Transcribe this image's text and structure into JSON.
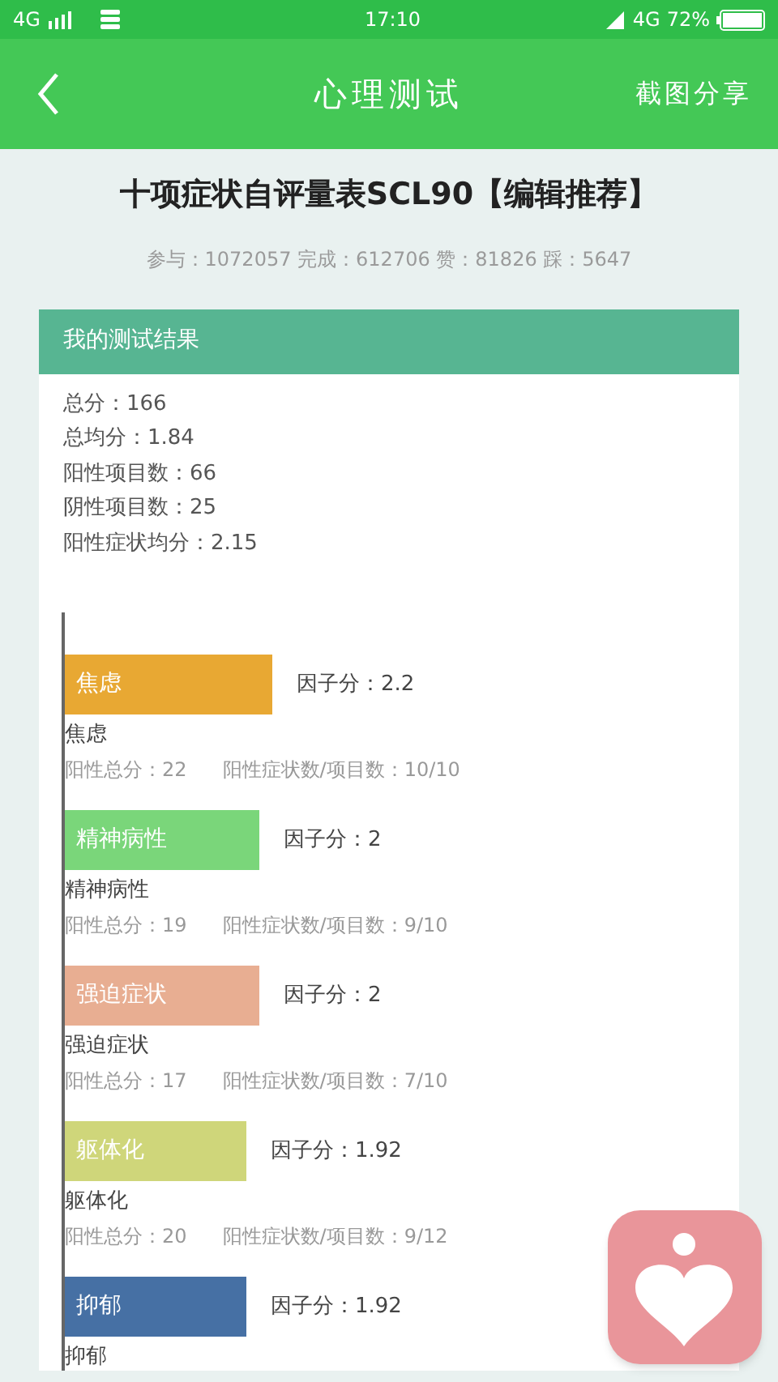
{
  "status_bar": {
    "network": "4G",
    "time": "17:10",
    "network_right": "4G",
    "battery": "72%"
  },
  "header": {
    "title": "心理测试",
    "action": "截图分享"
  },
  "test": {
    "title": "十项症状自评量表SCL90【编辑推荐】",
    "stats": "参与：1072057 完成：612706 赞：81826 踩：5647"
  },
  "result": {
    "title": "我的测试结果",
    "summary": [
      "总分：166",
      "总均分：1.84",
      "阳性项目数：66",
      "阴性项目数：25",
      "阳性症状均分：2.15"
    ],
    "factors": [
      {
        "name": "焦虑",
        "color": "#e8a833",
        "score": "因子分：2.2",
        "caption": "焦虑",
        "total": "阳性总分：22",
        "ratio": "阳性症状数/项目数：10/10"
      },
      {
        "name": "精神病性",
        "color": "#7ad67a",
        "score": "因子分：2",
        "caption": "精神病性",
        "total": "阳性总分：19",
        "ratio": "阳性症状数/项目数：9/10"
      },
      {
        "name": "强迫症状",
        "color": "#e8ae92",
        "score": "因子分：2",
        "caption": "强迫症状",
        "total": "阳性总分：17",
        "ratio": "阳性症状数/项目数：7/10"
      },
      {
        "name": "躯体化",
        "color": "#cfd67a",
        "score": "因子分：1.92",
        "caption": "躯体化",
        "total": "阳性总分：20",
        "ratio": "阳性症状数/项目数：9/12"
      },
      {
        "name": "抑郁",
        "color": "#4670a4",
        "score": "因子分：1.92",
        "caption": "抑郁"
      }
    ]
  }
}
